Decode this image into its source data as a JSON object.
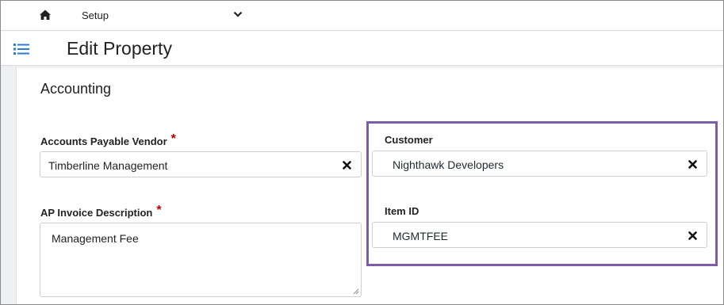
{
  "nav": {
    "home_icon": "home-icon",
    "module": "Setup",
    "caret_icon": "chevron-down-icon"
  },
  "header": {
    "menu_icon": "list-icon",
    "title": "Edit Property"
  },
  "section": {
    "title": "Accounting"
  },
  "fields": {
    "ap_vendor": {
      "label": "Accounts Payable Vendor",
      "required": "*",
      "value": "Timberline Management"
    },
    "ap_invoice_description": {
      "label": "AP Invoice Description",
      "required": "*",
      "value": "Management Fee"
    },
    "customer": {
      "label": "Customer",
      "value": "Nighthawk Developers"
    },
    "item_id": {
      "label": "Item ID",
      "value": "MGMTFEE"
    }
  },
  "colors": {
    "highlight_border": "#7b5ea7",
    "required_asterisk": "#c00000",
    "menu_icon": "#2d7ad6"
  }
}
